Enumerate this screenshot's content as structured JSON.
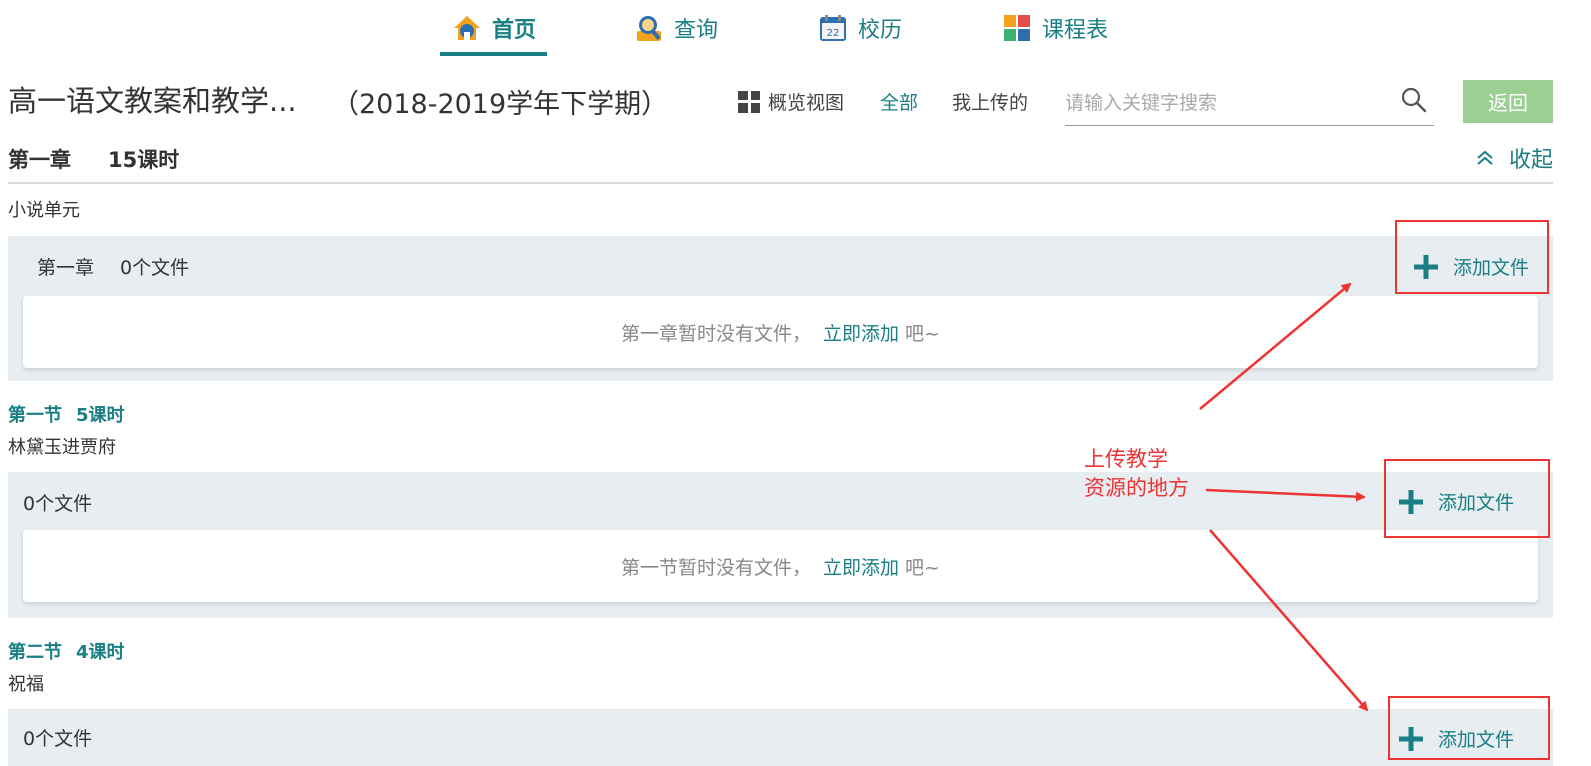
{
  "nav": {
    "items": [
      {
        "label": "首页",
        "icon": "home-icon"
      },
      {
        "label": "查询",
        "icon": "search-person-icon"
      },
      {
        "label": "校历",
        "icon": "calendar-icon"
      },
      {
        "label": "课程表",
        "icon": "timetable-icon"
      }
    ],
    "active_index": 0
  },
  "header": {
    "title": "高一语文教案和教学...",
    "term": "（2018-2019学年下学期）",
    "overview_label": "概览视图",
    "filter_all": "全部",
    "filter_mine": "我上传的",
    "search_placeholder": "请输入关键字搜索",
    "back_label": "返回"
  },
  "chapter": {
    "name": "第一章",
    "hours": "15课时",
    "collapse_label": "收起",
    "unit_label": "小说单元",
    "panel_label": "第一章",
    "panel_count": "0个文件",
    "add_label": "添加文件",
    "empty_text": "第一章暂时没有文件，",
    "empty_link": "立即添加",
    "empty_tail": "吧~"
  },
  "sections": [
    {
      "name": "第一节",
      "hours": "5课时",
      "subtitle": "林黛玉进贾府",
      "count": "0个文件",
      "add_label": "添加文件",
      "empty_text": "第一节暂时没有文件，",
      "empty_link": "立即添加",
      "empty_tail": "吧~"
    },
    {
      "name": "第二节",
      "hours": "4课时",
      "subtitle": "祝福",
      "count": "0个文件",
      "add_label": "添加文件"
    }
  ],
  "annotation": {
    "line1": "上传教学",
    "line2": "资源的地方"
  },
  "colors": {
    "accent": "#1a7f84",
    "panel_bg": "#e8edf2",
    "back_button": "#9ccf92",
    "annotation": "#e33333"
  }
}
